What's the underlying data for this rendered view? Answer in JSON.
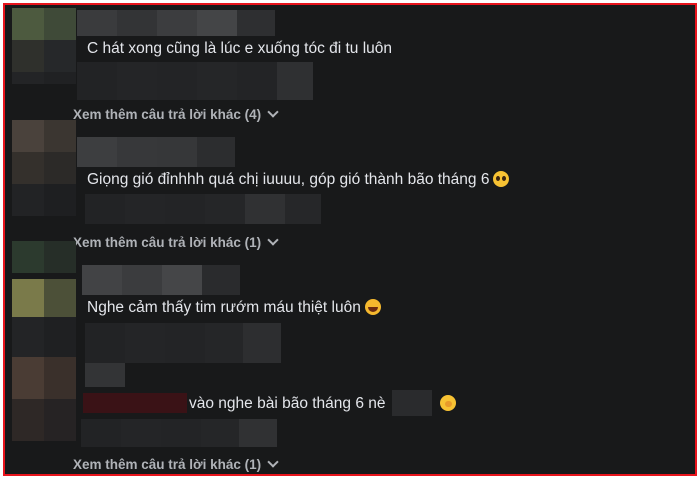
{
  "comments": [
    {
      "text": "C hát xong cũng là lúc e xuống tóc đi tu luôn",
      "emoji": ""
    },
    {
      "text": "Giọng gió đỉnhhh quá chị iuuuu, góp gió thành bão tháng 6",
      "emoji": "pleading-face-icon"
    },
    {
      "text": "Nghe cảm thấy tim rướm máu thiệt luôn",
      "emoji": "laughing-face-icon"
    },
    {
      "text": "vào nghe bài bão tháng 6 nè",
      "emoji": "hand-over-mouth-face-icon"
    }
  ],
  "more_replies": [
    "Xem thêm câu trả lời khác (4)",
    "Xem thêm câu trả lời khác (1)",
    "Xem thêm câu trả lời khác (1)"
  ],
  "colors": {
    "background": "#18191a",
    "text": "#e4e6eb",
    "muted": "#b0b3b8",
    "border": "#e8141c"
  }
}
